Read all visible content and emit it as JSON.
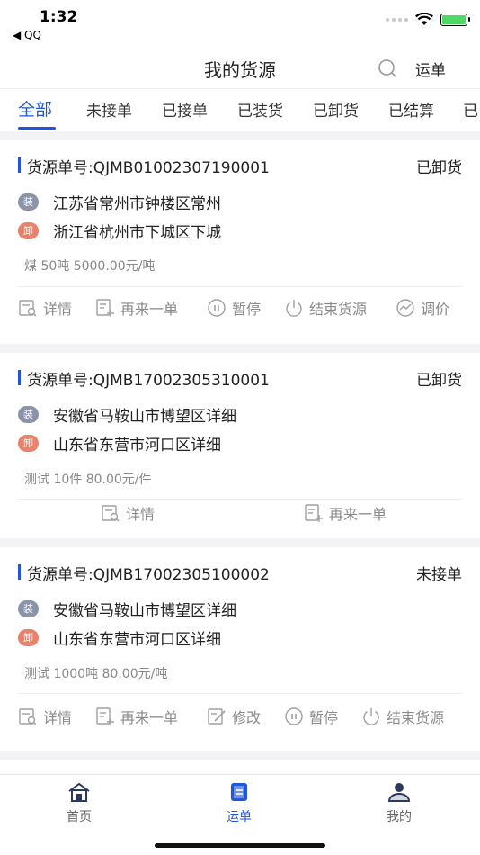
{
  "status_bar": {
    "time": "1:32",
    "back_app": "◀ QQ"
  },
  "header": {
    "title": "我的货源",
    "right_action": "运单"
  },
  "tabs": [
    {
      "label": "全部",
      "active": true
    },
    {
      "label": "未接单"
    },
    {
      "label": "已接单"
    },
    {
      "label": "已装货"
    },
    {
      "label": "已卸货"
    },
    {
      "label": "已结算"
    },
    {
      "label": "已"
    }
  ],
  "cards": [
    {
      "order_label": "货源单号:QJMB01002307190001",
      "status": "已卸货",
      "load_badge": "装",
      "unload_badge": "卸",
      "load_addr": "江苏省常州市钟楼区常州",
      "unload_addr": "浙江省杭州市下城区下城",
      "cargo": "煤 50吨 5000.00元/吨",
      "actions": [
        "详情",
        "再来一单",
        "暂停",
        "结束货源",
        "调价"
      ]
    },
    {
      "order_label": "货源单号:QJMB17002305310001",
      "status": "已卸货",
      "load_badge": "装",
      "unload_badge": "卸",
      "load_addr": "安徽省马鞍山市博望区详细",
      "unload_addr": "山东省东营市河口区详细",
      "cargo": "测试 10件 80.00元/件",
      "actions": [
        "详情",
        "再来一单"
      ]
    },
    {
      "order_label": "货源单号:QJMB17002305100002",
      "status": "未接单",
      "load_badge": "装",
      "unload_badge": "卸",
      "load_addr": "安徽省马鞍山市博望区详细",
      "unload_addr": "山东省东营市河口区详细",
      "cargo": "测试 1000吨 80.00元/吨",
      "actions": [
        "详情",
        "再来一单",
        "修改",
        "暂停",
        "结束货源"
      ]
    }
  ],
  "bottom_nav": [
    {
      "label": "首页",
      "icon": "home-icon"
    },
    {
      "label": "运单",
      "icon": "waybill-icon",
      "active": true
    },
    {
      "label": "我的",
      "icon": "profile-icon"
    }
  ],
  "colors": {
    "accent": "#1e56e0",
    "load_badge": "#8a93a8",
    "unload_badge": "#e8826b"
  }
}
